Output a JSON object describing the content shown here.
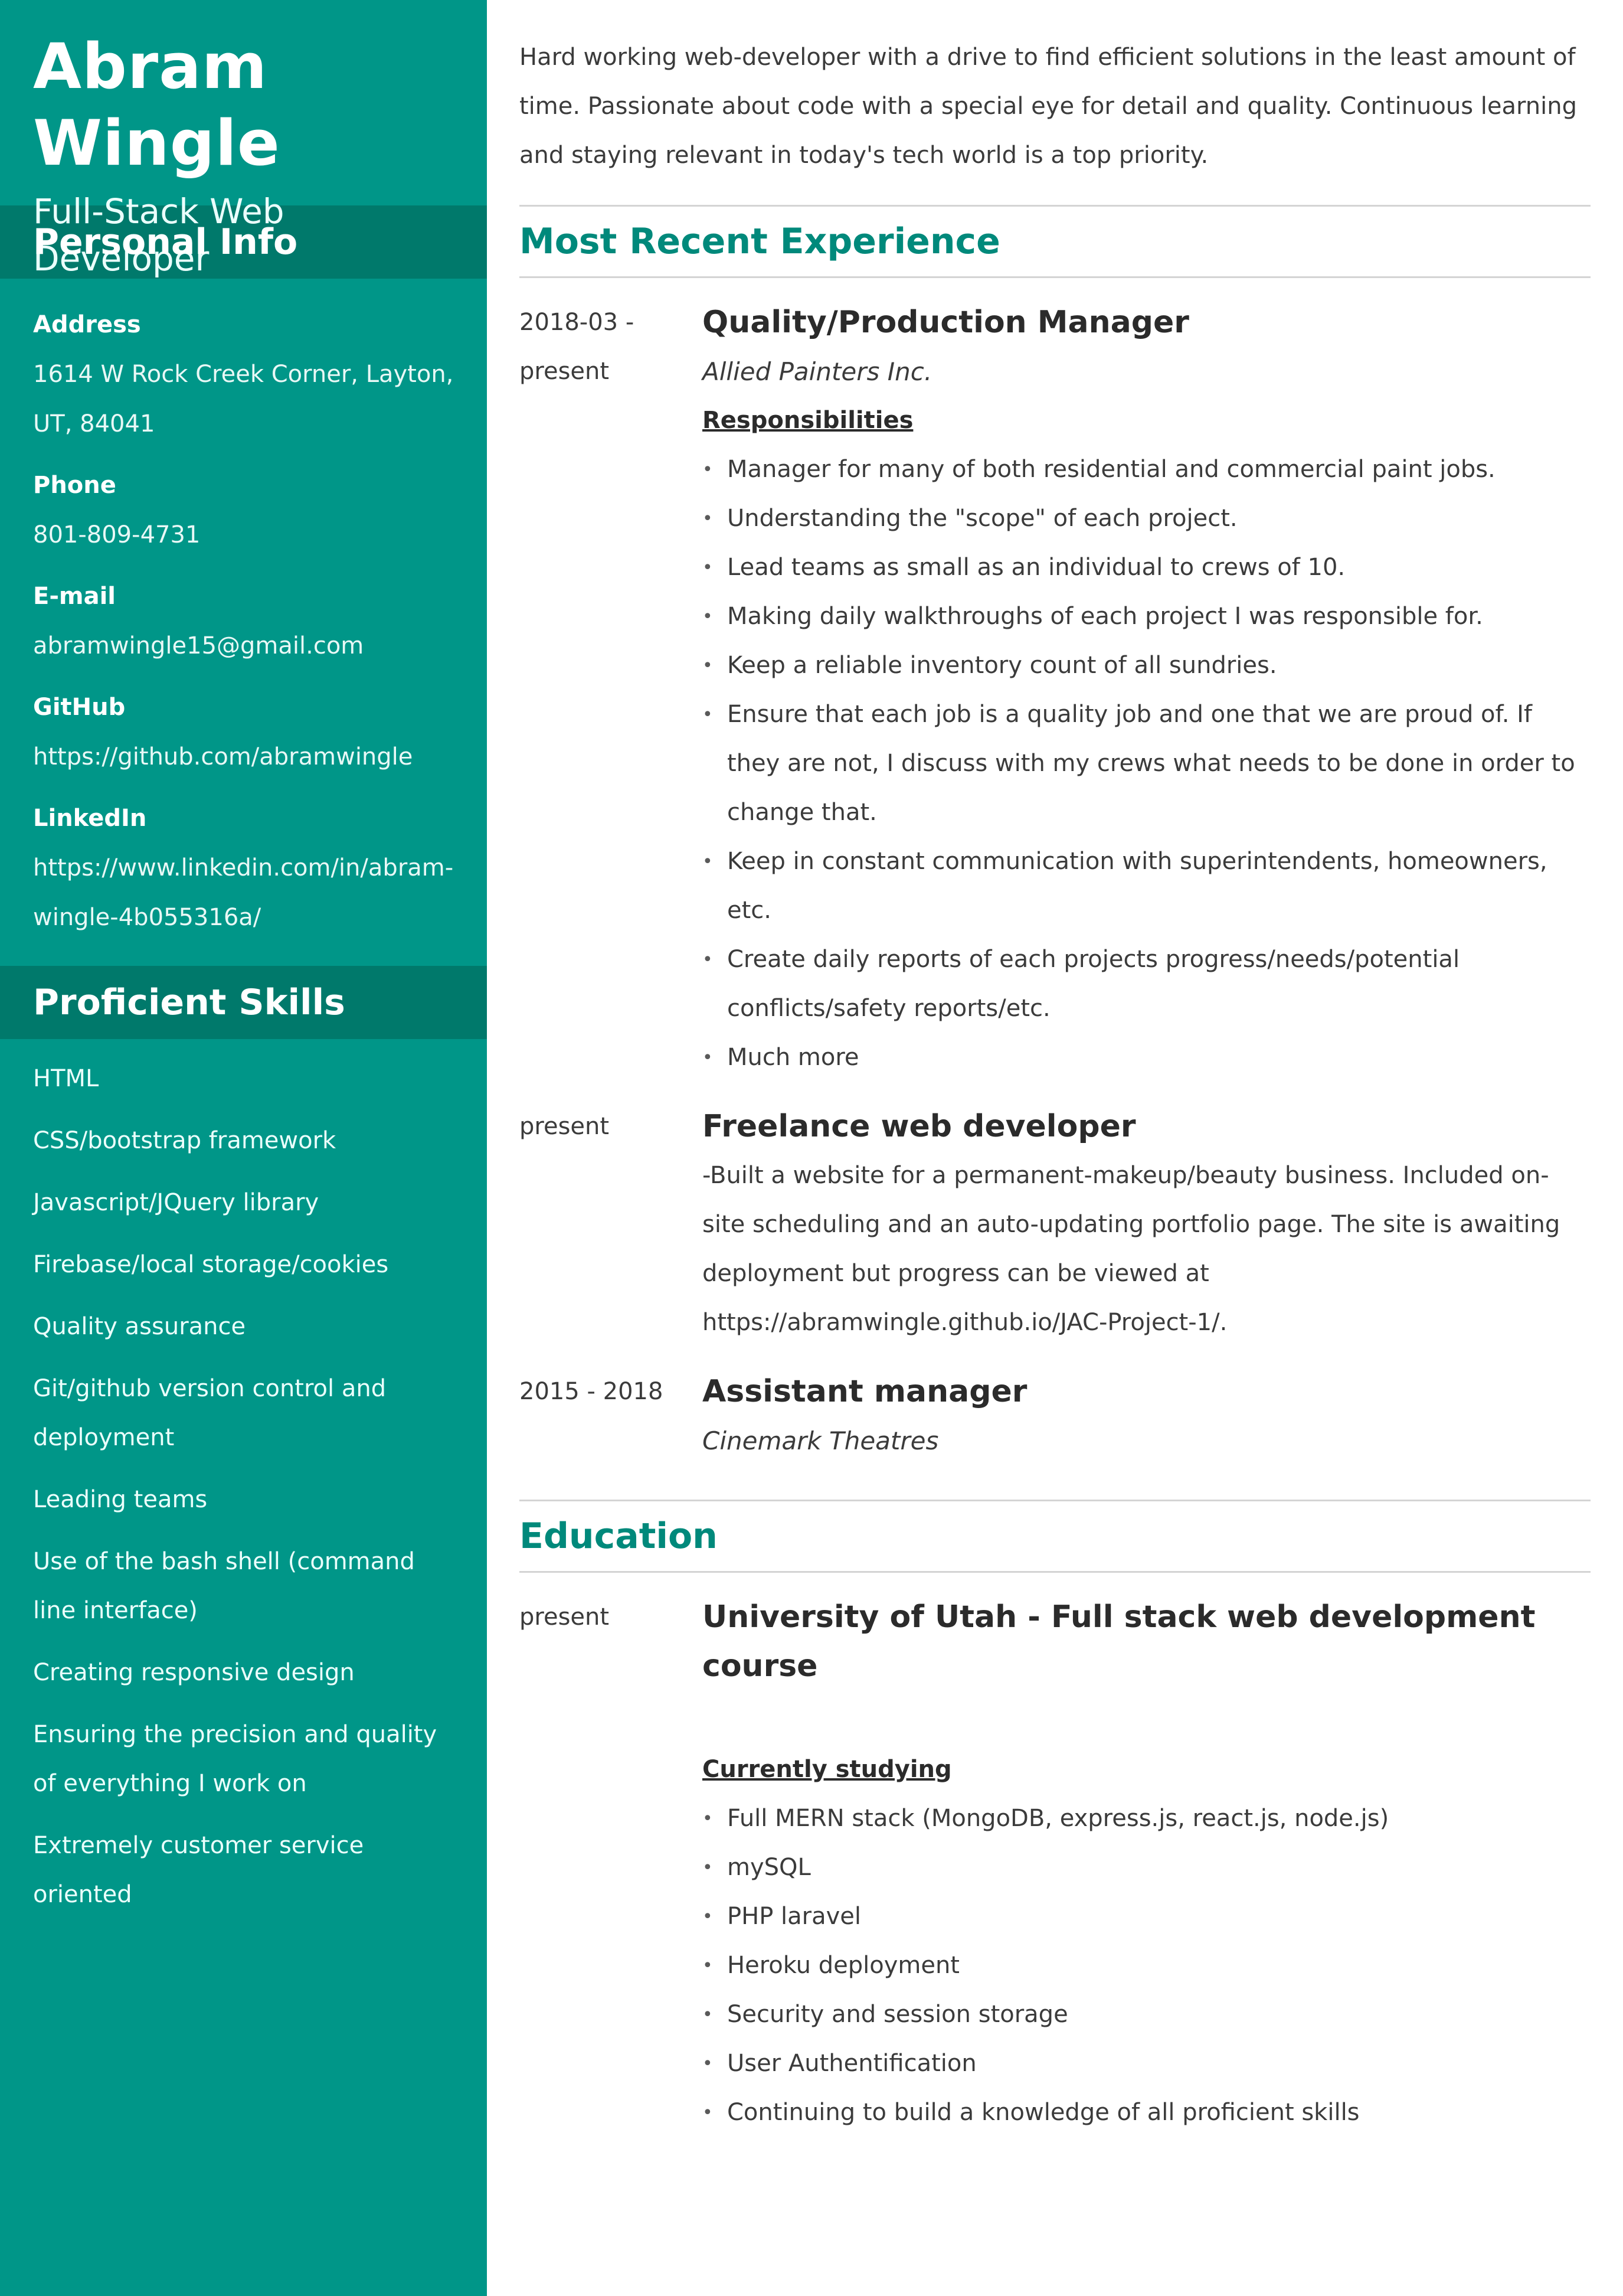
{
  "header": {
    "name": "Abram Wingle",
    "title": "Full-Stack Web Developer"
  },
  "personal_info": {
    "heading": "Personal Info",
    "items": [
      {
        "label": "Address",
        "value": "1614 W Rock Creek Corner, Layton, UT, 84041"
      },
      {
        "label": "Phone",
        "value": "801-809-4731"
      },
      {
        "label": "E-mail",
        "value": "abramwingle15@gmail.com"
      },
      {
        "label": "GitHub",
        "value": "https://github.com/abramwingle"
      },
      {
        "label": "LinkedIn",
        "value": "https://www.linkedin.com/in/abram-wingle-4b055316a/"
      }
    ]
  },
  "skills": {
    "heading": "Proficient Skills",
    "items": [
      "HTML",
      "CSS/bootstrap framework",
      "Javascript/JQuery library",
      "Firebase/local storage/cookies",
      "Quality assurance",
      "Git/github version control and deployment",
      "Leading teams",
      "Use of the bash shell (command line interface)",
      "Creating responsive design",
      "Ensuring the precision and quality of everything I work on",
      "Extremely customer service oriented"
    ]
  },
  "summary": "Hard working web-developer with a drive to find efficient solutions in the least amount of time. Passionate about code with a special eye for detail and quality. Continuous learning and staying relevant in today's tech world is a top priority.",
  "experience": {
    "heading": "Most Recent Experience",
    "jobs": [
      {
        "date": "2018-03 - present",
        "title": "Quality/Production Manager",
        "company": "Allied Painters Inc.",
        "sub_heading": "Responsibilities",
        "bullets": [
          "Manager for many of both residential and commercial paint jobs.",
          "Understanding the \"scope\" of each project.",
          "Lead teams as small as an individual to crews of 10.",
          "Making daily walkthroughs of each project I was responsible for.",
          "Keep a reliable inventory count of all sundries.",
          "Ensure that each job is a quality job and one that we are proud of. If they are not, I discuss with my crews what needs to be done in order to change that.",
          "Keep in constant communication with superintendents, homeowners, etc.",
          "Create daily reports of each projects progress/needs/potential conflicts/safety reports/etc.",
          "Much more"
        ]
      },
      {
        "date": "present",
        "title": "Freelance web developer",
        "description": "-Built a website for a permanent-makeup/beauty business. Included on-site scheduling and an auto-updating portfolio page. The site is awaiting deployment but progress can be viewed at https://abramwingle.github.io/JAC-Project-1/."
      },
      {
        "date": "2015 - 2018",
        "title": "Assistant manager",
        "company": "Cinemark Theatres"
      }
    ]
  },
  "education": {
    "heading": "Education",
    "entry": {
      "date": "present",
      "title": "University of Utah - Full stack web development course",
      "sub_heading": "Currently studying",
      "bullets": [
        "Full MERN stack (MongoDB, express.js, react.js, node.js)",
        "mySQL",
        "PHP laravel",
        "Heroku deployment",
        "Security and session storage",
        "User Authentification",
        "Continuing to build a knowledge of all proficient skills"
      ]
    }
  },
  "colors": {
    "sidebar": "#009688",
    "sidebar_section": "#00796b",
    "accent": "#00897b"
  }
}
